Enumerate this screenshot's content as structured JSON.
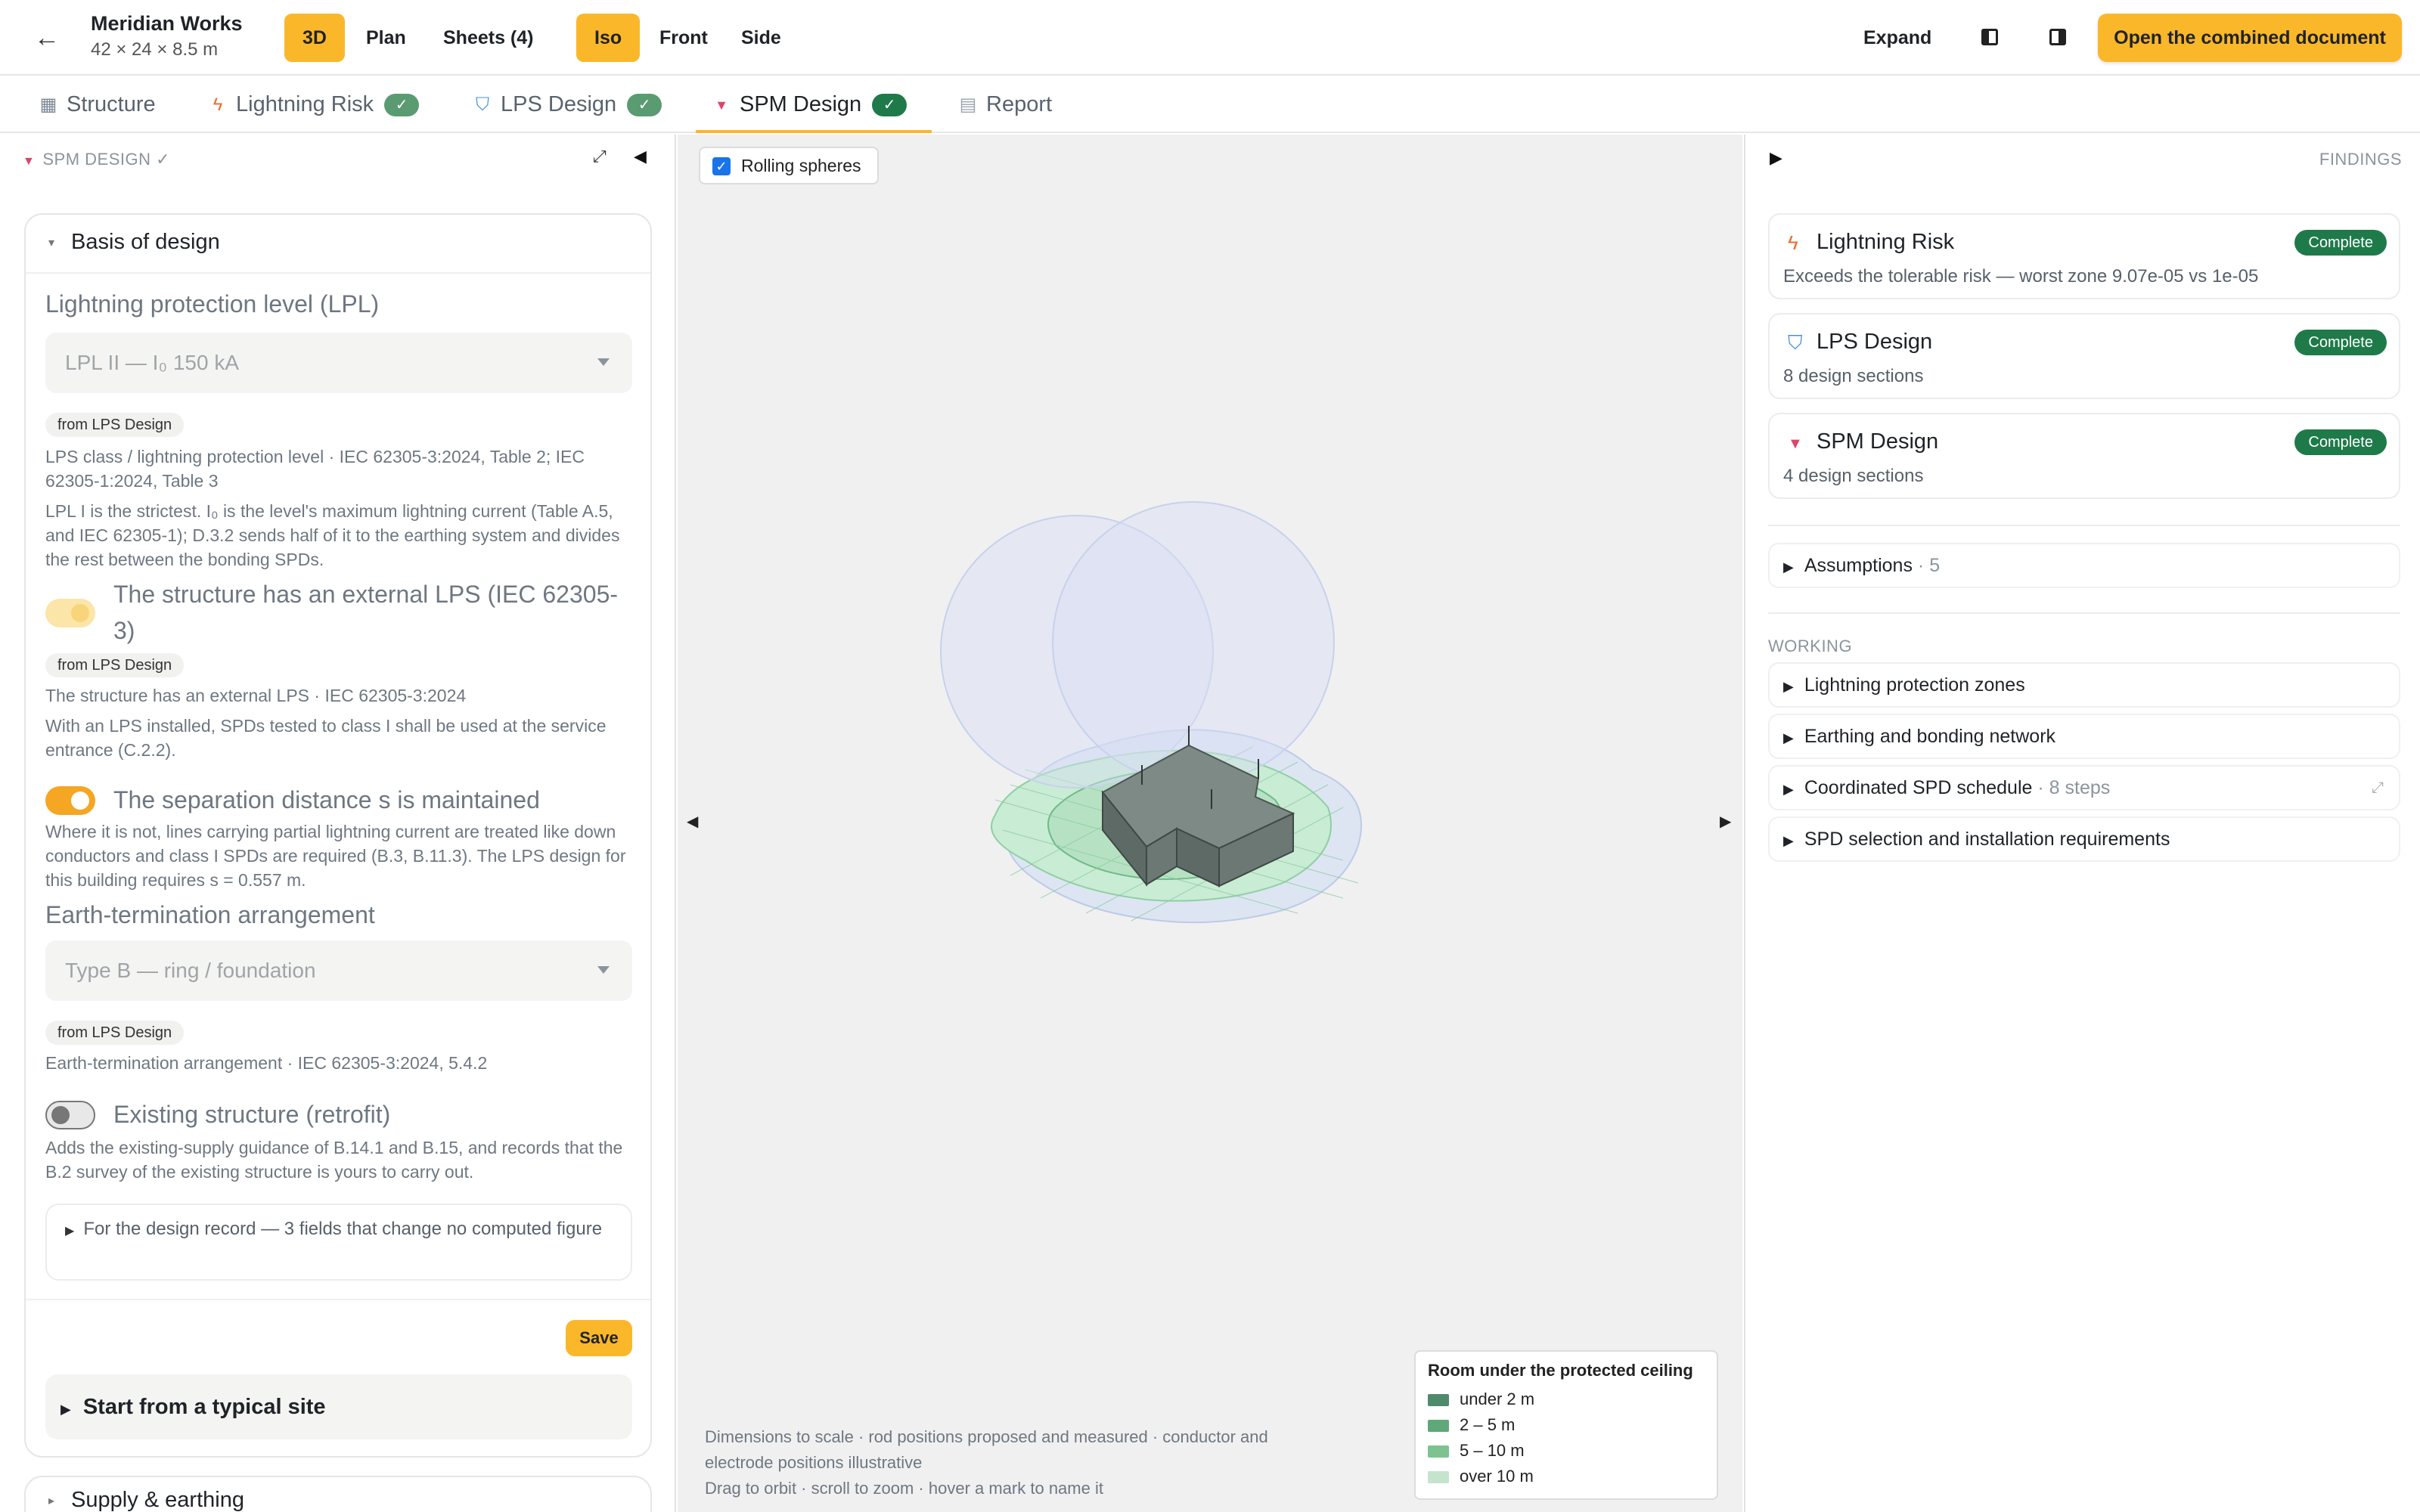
{
  "topbar": {
    "back_glyph": "←",
    "project_name": "Meridian Works",
    "project_dims": "42 × 24 × 8.5 m",
    "view_modes": [
      "3D",
      "Plan",
      "Sheets (4)"
    ],
    "active_view_mode": "3D",
    "projections": [
      "Iso",
      "Front",
      "Side"
    ],
    "active_projection": "Iso",
    "expand_label": "Expand",
    "open_document_label": "Open the combined document"
  },
  "tabs": [
    {
      "label": "Structure",
      "icon": "building-icon",
      "complete": false
    },
    {
      "label": "Lightning Risk",
      "icon": "lightning-icon",
      "complete": true
    },
    {
      "label": "LPS Design",
      "icon": "shield-icon",
      "complete": true
    },
    {
      "label": "SPM Design",
      "icon": "triangle-down-icon",
      "complete": true,
      "active": true
    },
    {
      "label": "Report",
      "icon": "document-icon",
      "complete": false
    }
  ],
  "check_glyph": "✓",
  "left_panel": {
    "header": "SPM DESIGN ✓",
    "basis": {
      "title": "Basis of design",
      "lpl_label": "Lightning protection level (LPL)",
      "lpl_value": "LPL II — I₀ 150 kA",
      "chip": "from LPS Design",
      "lpl_note1": "LPS class / lightning protection level · IEC 62305-3:2024, Table 2; IEC 62305-1:2024, Table 3",
      "lpl_note2": "LPL I is the strictest. I₀ is the level's maximum lightning current (Table A.5, and IEC 62305-1); D.3.2 sends half of it to the earthing system and divides the rest between the bonding SPDs.",
      "external_lps_label": "The structure has an external LPS (IEC 62305-3)",
      "external_lps_on": true,
      "external_lps_note1": "The structure has an external LPS · IEC 62305-3:2024",
      "external_lps_note2": "With an LPS installed, SPDs tested to class I shall be used at the service entrance (C.2.2).",
      "separation_label": "The separation distance s is maintained",
      "separation_on": true,
      "separation_note": "Where it is not, lines carrying partial lightning current are treated like down conductors and class I SPDs are required (B.3, B.11.3). The LPS design for this building requires s = 0.557 m.",
      "earth_label": "Earth-termination arrangement",
      "earth_value": "Type B — ring / foundation",
      "earth_note": "Earth-termination arrangement · IEC 62305-3:2024, 5.4.2",
      "retrofit_label": "Existing structure (retrofit)",
      "retrofit_on": false,
      "retrofit_note": "Adds the existing-supply guidance of B.14.1 and B.15, and records that the B.2 survey of the existing structure is yours to carry out.",
      "design_record": "For the design record — 3 fields that change no computed figure",
      "save_label": "Save",
      "typical_site": "Start from a typical site"
    },
    "supply_title": "Supply & earthing"
  },
  "viewport": {
    "rolling_spheres_label": "Rolling spheres",
    "rolling_spheres_checked": true,
    "legend": {
      "title": "Room under the protected ceiling",
      "items": [
        {
          "label": "under 2 m",
          "color": "#4f8a6a"
        },
        {
          "label": "2 – 5 m",
          "color": "#5fa878"
        },
        {
          "label": "5 – 10 m",
          "color": "#7cc391"
        },
        {
          "label": "over 10 m",
          "color": "#c5e4cd"
        }
      ]
    },
    "footnote1": "Dimensions to scale · rod positions proposed and measured · conductor and electrode positions illustrative",
    "footnote2": "Drag to orbit · scroll to zoom · hover a mark to name it"
  },
  "right_panel": {
    "header": "FINDINGS",
    "findings": [
      {
        "name": "Lightning Risk",
        "icon": "lightning-icon",
        "badge": "Complete",
        "sub": "Exceeds the tolerable risk — worst zone 9.07e-05 vs 1e-05"
      },
      {
        "name": "LPS Design",
        "icon": "shield-icon",
        "badge": "Complete",
        "sub": "8 design sections"
      },
      {
        "name": "SPM Design",
        "icon": "triangle-down-icon",
        "badge": "Complete",
        "sub": "4 design sections"
      }
    ],
    "assumptions": {
      "label": "Assumptions",
      "count": "· 5"
    },
    "working_header": "WORKING",
    "working": [
      {
        "label": "Lightning protection zones",
        "meta": ""
      },
      {
        "label": "Earthing and bonding network",
        "meta": ""
      },
      {
        "label": "Coordinated SPD schedule",
        "meta": "· 8 steps"
      },
      {
        "label": "SPD selection and installation requirements",
        "meta": ""
      }
    ]
  }
}
